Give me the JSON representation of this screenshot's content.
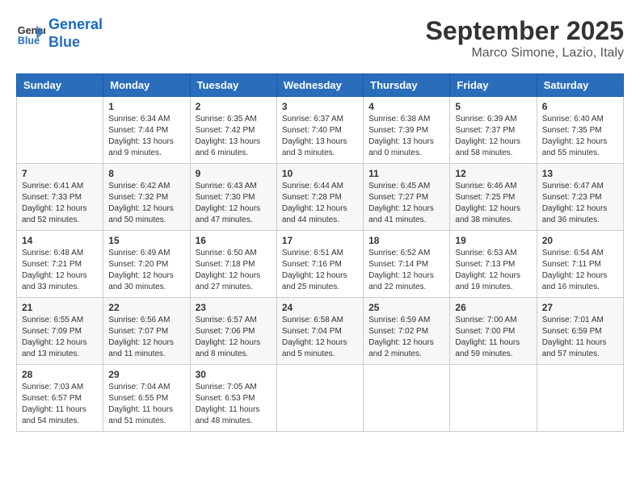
{
  "header": {
    "logo_line1": "General",
    "logo_line2": "Blue",
    "month": "September 2025",
    "location": "Marco Simone, Lazio, Italy"
  },
  "days_of_week": [
    "Sunday",
    "Monday",
    "Tuesday",
    "Wednesday",
    "Thursday",
    "Friday",
    "Saturday"
  ],
  "weeks": [
    [
      {
        "num": "",
        "empty": true
      },
      {
        "num": "1",
        "rise": "6:34 AM",
        "set": "7:44 PM",
        "daylight": "13 hours and 9 minutes."
      },
      {
        "num": "2",
        "rise": "6:35 AM",
        "set": "7:42 PM",
        "daylight": "13 hours and 6 minutes."
      },
      {
        "num": "3",
        "rise": "6:37 AM",
        "set": "7:40 PM",
        "daylight": "13 hours and 3 minutes."
      },
      {
        "num": "4",
        "rise": "6:38 AM",
        "set": "7:39 PM",
        "daylight": "13 hours and 0 minutes."
      },
      {
        "num": "5",
        "rise": "6:39 AM",
        "set": "7:37 PM",
        "daylight": "12 hours and 58 minutes."
      },
      {
        "num": "6",
        "rise": "6:40 AM",
        "set": "7:35 PM",
        "daylight": "12 hours and 55 minutes."
      }
    ],
    [
      {
        "num": "7",
        "rise": "6:41 AM",
        "set": "7:33 PM",
        "daylight": "12 hours and 52 minutes."
      },
      {
        "num": "8",
        "rise": "6:42 AM",
        "set": "7:32 PM",
        "daylight": "12 hours and 50 minutes."
      },
      {
        "num": "9",
        "rise": "6:43 AM",
        "set": "7:30 PM",
        "daylight": "12 hours and 47 minutes."
      },
      {
        "num": "10",
        "rise": "6:44 AM",
        "set": "7:28 PM",
        "daylight": "12 hours and 44 minutes."
      },
      {
        "num": "11",
        "rise": "6:45 AM",
        "set": "7:27 PM",
        "daylight": "12 hours and 41 minutes."
      },
      {
        "num": "12",
        "rise": "6:46 AM",
        "set": "7:25 PM",
        "daylight": "12 hours and 38 minutes."
      },
      {
        "num": "13",
        "rise": "6:47 AM",
        "set": "7:23 PM",
        "daylight": "12 hours and 36 minutes."
      }
    ],
    [
      {
        "num": "14",
        "rise": "6:48 AM",
        "set": "7:21 PM",
        "daylight": "12 hours and 33 minutes."
      },
      {
        "num": "15",
        "rise": "6:49 AM",
        "set": "7:20 PM",
        "daylight": "12 hours and 30 minutes."
      },
      {
        "num": "16",
        "rise": "6:50 AM",
        "set": "7:18 PM",
        "daylight": "12 hours and 27 minutes."
      },
      {
        "num": "17",
        "rise": "6:51 AM",
        "set": "7:16 PM",
        "daylight": "12 hours and 25 minutes."
      },
      {
        "num": "18",
        "rise": "6:52 AM",
        "set": "7:14 PM",
        "daylight": "12 hours and 22 minutes."
      },
      {
        "num": "19",
        "rise": "6:53 AM",
        "set": "7:13 PM",
        "daylight": "12 hours and 19 minutes."
      },
      {
        "num": "20",
        "rise": "6:54 AM",
        "set": "7:11 PM",
        "daylight": "12 hours and 16 minutes."
      }
    ],
    [
      {
        "num": "21",
        "rise": "6:55 AM",
        "set": "7:09 PM",
        "daylight": "12 hours and 13 minutes."
      },
      {
        "num": "22",
        "rise": "6:56 AM",
        "set": "7:07 PM",
        "daylight": "12 hours and 11 minutes."
      },
      {
        "num": "23",
        "rise": "6:57 AM",
        "set": "7:06 PM",
        "daylight": "12 hours and 8 minutes."
      },
      {
        "num": "24",
        "rise": "6:58 AM",
        "set": "7:04 PM",
        "daylight": "12 hours and 5 minutes."
      },
      {
        "num": "25",
        "rise": "6:59 AM",
        "set": "7:02 PM",
        "daylight": "12 hours and 2 minutes."
      },
      {
        "num": "26",
        "rise": "7:00 AM",
        "set": "7:00 PM",
        "daylight": "11 hours and 59 minutes."
      },
      {
        "num": "27",
        "rise": "7:01 AM",
        "set": "6:59 PM",
        "daylight": "11 hours and 57 minutes."
      }
    ],
    [
      {
        "num": "28",
        "rise": "7:03 AM",
        "set": "6:57 PM",
        "daylight": "11 hours and 54 minutes."
      },
      {
        "num": "29",
        "rise": "7:04 AM",
        "set": "6:55 PM",
        "daylight": "11 hours and 51 minutes."
      },
      {
        "num": "30",
        "rise": "7:05 AM",
        "set": "6:53 PM",
        "daylight": "11 hours and 48 minutes."
      },
      {
        "num": "",
        "empty": true
      },
      {
        "num": "",
        "empty": true
      },
      {
        "num": "",
        "empty": true
      },
      {
        "num": "",
        "empty": true
      }
    ]
  ],
  "labels": {
    "sunrise": "Sunrise:",
    "sunset": "Sunset:",
    "daylight": "Daylight:"
  }
}
